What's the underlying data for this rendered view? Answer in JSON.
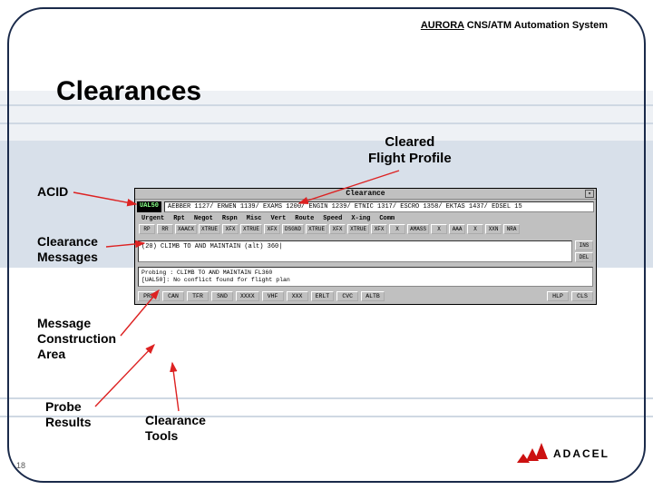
{
  "header": {
    "brand_u": "AURORA",
    "brand_rest": " CNS/ATM Automation System"
  },
  "title": "Clearances",
  "subtitle_l1": "Cleared",
  "subtitle_l2": "Flight Profile",
  "labels": {
    "acid": "ACID",
    "clearance_messages_l1": "Clearance",
    "clearance_messages_l2": "Messages",
    "msg_construct_l1": "Message",
    "msg_construct_l2": "Construction",
    "msg_construct_l3": "Area",
    "probe_l1": "Probe",
    "probe_l2": "Results",
    "tools_l1": "Clearance",
    "tools_l2": "Tools"
  },
  "window": {
    "title": "Clearance",
    "acid_value": "UAL50",
    "profile": "AEBBER 1127/ ERWEN 1139/ EXAMS 1200/ ENGIN 1239/ ETNIC 1317/ ESCRO 1358/ EKTAS 1437/ EDSEL 15",
    "categories": [
      "Urgent",
      "Rpt",
      "Negot",
      "Rspn",
      "Misc",
      "Vert",
      "Route",
      "Speed",
      "X-ing",
      "Comm"
    ],
    "msg_buttons": [
      "RP",
      "RR",
      "XAACX",
      "XTRUE",
      "XFX",
      "XTRUE",
      "XFX",
      "DSGND",
      "XTRUE",
      "XFX",
      "XTRUE",
      "XFX",
      "X",
      "AMASS",
      "X",
      "AAA",
      "X",
      "XXN",
      "NRA"
    ],
    "construct_text": "(20) CLIMB TO AND MAINTAIN (alt) 360|",
    "side_buttons": [
      "INS",
      "DEL"
    ],
    "probe_l1": "Probing : CLIMB TO AND MAINTAIN FL360",
    "probe_l2": "[UAL50]: No conflict found for flight plan",
    "tool_buttons_left": [
      "PRB",
      "CAN",
      "TFR",
      "SND",
      "XXXX",
      "VHF",
      "XXX",
      "ERLT",
      "CVC",
      "ALTB"
    ],
    "tool_buttons_right": [
      "HLP",
      "CLS"
    ]
  },
  "page_number": "18",
  "logo_text": "ADACEL"
}
